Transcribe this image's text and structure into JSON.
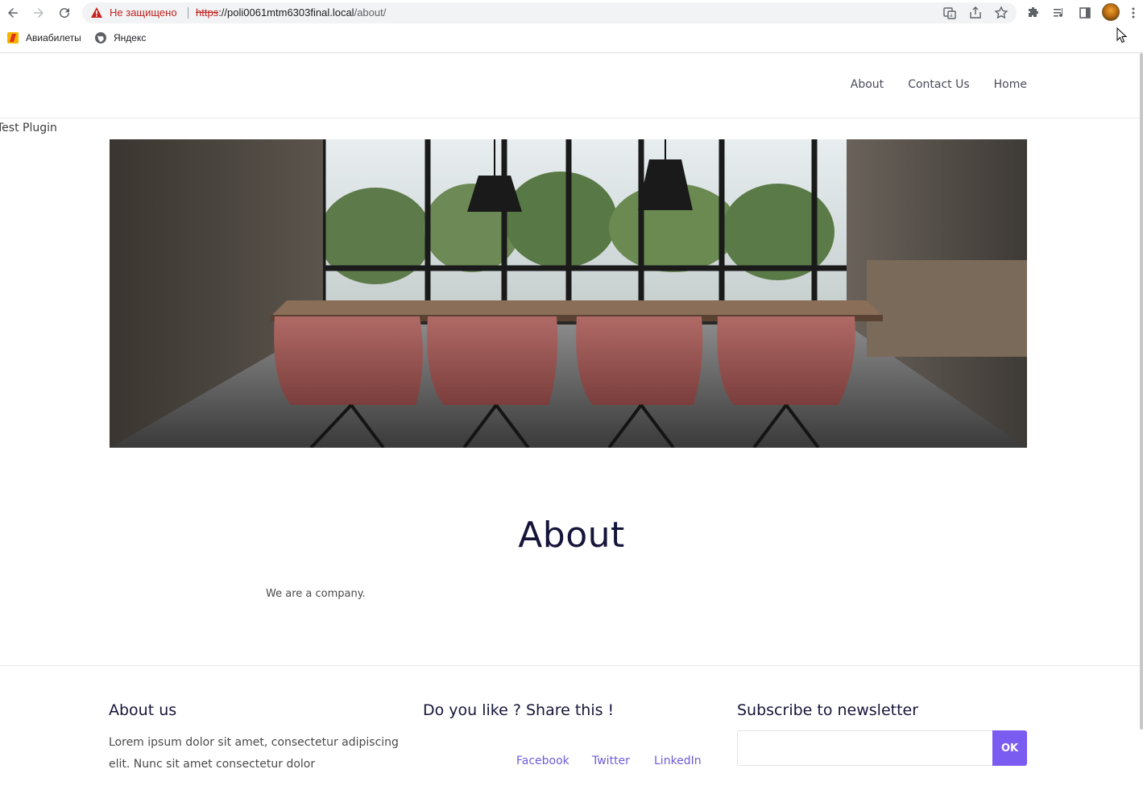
{
  "browser": {
    "security_label": "Не защищено",
    "url_scheme": "https",
    "url_host": "://poli0061mtm6303final.local",
    "url_path": "/about/",
    "bookmarks": [
      {
        "label": "Авиабилеты",
        "icon": "aviatickets-icon"
      },
      {
        "label": "Яндекс",
        "icon": "globe-icon"
      }
    ]
  },
  "site": {
    "menu": [
      "About",
      "Contact Us",
      "Home"
    ],
    "plugin_text": "Test Plugin",
    "page_title": "About",
    "page_body": "We are a company.",
    "accent_color": "#7b5cf0",
    "hero_image": "meeting-room-photo"
  },
  "footer": {
    "about_title": "About us",
    "about_text": "Lorem ipsum dolor sit amet, consectetur adipiscing elit. Nunc sit amet consectetur dolor",
    "share_title": "Do you like ? Share this !",
    "share_links": [
      "Facebook",
      "Twitter",
      "LinkedIn"
    ],
    "newsletter_title": "Subscribe to newsletter",
    "newsletter_button": "OK"
  }
}
